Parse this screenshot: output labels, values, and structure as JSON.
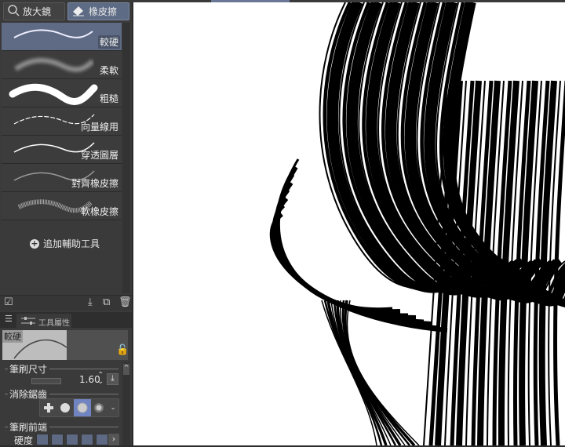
{
  "tool_tabs": [
    {
      "label": "放大鏡",
      "icon": "magnifier-icon"
    },
    {
      "label": "橡皮擦",
      "icon": "eraser-icon",
      "active": true
    }
  ],
  "sub_tools": [
    {
      "label": "較硬",
      "selected": true
    },
    {
      "label": "柔軟"
    },
    {
      "label": "粗糙"
    },
    {
      "label": "向量線用"
    },
    {
      "label": "穿透圖層"
    },
    {
      "label": "對齊橡皮擦"
    },
    {
      "label": "軟橡皮擦"
    }
  ],
  "add_subtool": "追加輔助工具",
  "property_tab": "工具屬性",
  "preview_label": "較硬",
  "brush_size": {
    "label": "筆刷尺寸",
    "value": "1.60"
  },
  "antialias": {
    "label": "消除鋸齒",
    "selected_index": 2
  },
  "brush_tip": {
    "label": "筆刷前端",
    "hardness_label": "硬度"
  },
  "colors": {
    "accent": "#5f6b85",
    "panel": "#3a3a3a"
  }
}
